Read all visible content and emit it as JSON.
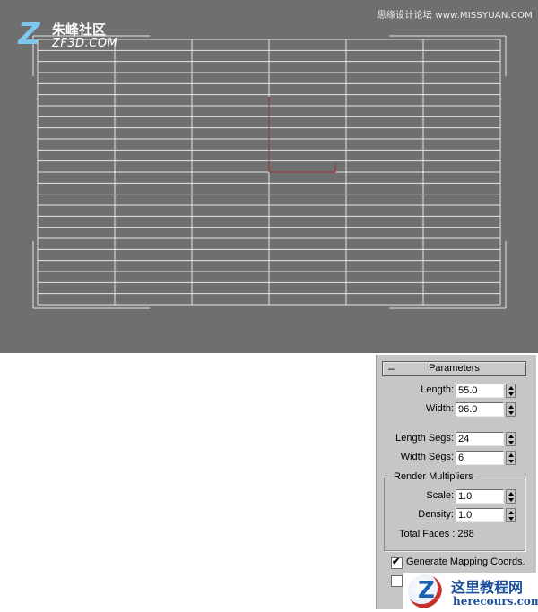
{
  "viewport": {
    "background": "#6f6f6f",
    "grid_color": "#e6e6e6",
    "axis_color": "#a03030",
    "watermark_top_right": "思缘设计论坛 www.MISSYUAN.COM",
    "logo": {
      "z_glyph": "Z",
      "chinese": "朱峰社区",
      "english": "ZF3D.COM"
    },
    "plane": {
      "length_segs": 24,
      "width_segs": 6
    }
  },
  "parameters": {
    "rollout_toggle": "–",
    "title": "Parameters",
    "length": {
      "label": "Length:",
      "value": "55.0"
    },
    "width": {
      "label": "Width:",
      "value": "96.0"
    },
    "length_segs": {
      "label": "Length Segs:",
      "value": "24"
    },
    "width_segs": {
      "label": "Width Segs:",
      "value": "6"
    },
    "render_multipliers": {
      "title": "Render Multipliers",
      "scale": {
        "label": "Scale:",
        "value": "1.0"
      },
      "density": {
        "label": "Density:",
        "value": "1.0"
      },
      "total_faces": "Total Faces : 288"
    },
    "generate_mapping": {
      "label": "Generate Mapping Coords.",
      "checked": true
    },
    "second_checkbox": {
      "checked": false
    }
  },
  "watermark_bottom": {
    "z_glyph": "Z",
    "chinese": "这里教程网",
    "english": "herecours.com"
  }
}
